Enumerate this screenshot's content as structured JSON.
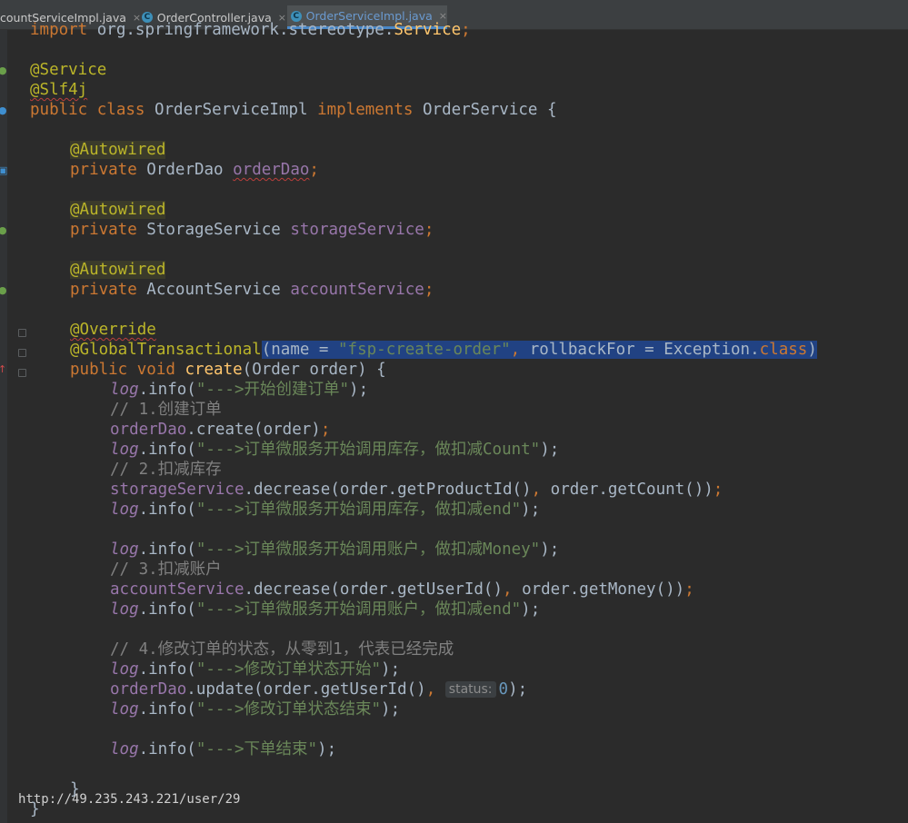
{
  "tabs": [
    {
      "label": "countServiceImpl.java",
      "icon": "",
      "close": "×"
    },
    {
      "label": "OrderController.java",
      "icon": "C",
      "close": "×"
    },
    {
      "label": "OrderServiceImpl.java",
      "icon": "C",
      "close": "×"
    }
  ],
  "code": {
    "line1": {
      "a": "import ",
      "b": "org.springframework.stereotype.",
      "c": "Service",
      "d": ";"
    },
    "line3": "@Service",
    "line4": "@Slf4j",
    "line5": {
      "a": "public class ",
      "b": "OrderServiceImpl ",
      "c": "implements ",
      "d": "OrderService {"
    },
    "line7": "@Autowired",
    "line8": {
      "a": "private ",
      "b": "OrderDao ",
      "c": "orderDao",
      "d": ";"
    },
    "line10": "@Autowired",
    "line11": {
      "a": "private ",
      "b": "StorageService ",
      "c": "storageService",
      "d": ";"
    },
    "line13": "@Autowired",
    "line14": {
      "a": "private ",
      "b": "AccountService ",
      "c": "accountService",
      "d": ";"
    },
    "line16": "@Override",
    "line17": {
      "a": "@GlobalTransactional",
      "b": "(name = ",
      "c": "\"fsp-create-order\"",
      "d": ", ",
      "e": "rollbackFor = Exception.",
      "f": "class",
      "g": ")"
    },
    "line18": {
      "a": "public void ",
      "b": "create",
      "c": "(Order order) {"
    },
    "line19": {
      "a": "log",
      "b": ".info(",
      "c": "\"--->开始创建订单\"",
      "d": ");"
    },
    "line20": "// 1.创建订单",
    "line21": {
      "a": "orderDao",
      "b": ".create(order)",
      "c": ";"
    },
    "line22": {
      "a": "log",
      "b": ".info(",
      "c": "\"--->订单微服务开始调用库存，做扣减Count\"",
      "d": ");"
    },
    "line23": "// 2.扣减库存",
    "line24": {
      "a": "storageService",
      "b": ".decrease(order.getProductId()",
      "c": ", ",
      "d": "order.getCount())",
      "e": ";"
    },
    "line25": {
      "a": "log",
      "b": ".info(",
      "c": "\"--->订单微服务开始调用库存，做扣减end\"",
      "d": ");"
    },
    "line27": {
      "a": "log",
      "b": ".info(",
      "c": "\"--->订单微服务开始调用账户，做扣减Money\"",
      "d": ");"
    },
    "line28": "// 3.扣减账户",
    "line29": {
      "a": "accountService",
      "b": ".decrease(order.getUserId()",
      "c": ", ",
      "d": "order.getMoney())",
      "e": ";"
    },
    "line30": {
      "a": "log",
      "b": ".info(",
      "c": "\"--->订单微服务开始调用账户，做扣减end\"",
      "d": ");"
    },
    "line32": "// 4.修改订单的状态，从零到1，代表已经完成",
    "line33": {
      "a": "log",
      "b": ".info(",
      "c": "\"--->修改订单状态开始\"",
      "d": ");"
    },
    "line34": {
      "a": "orderDao",
      "b": ".update(order.getUserId()",
      "c": ", ",
      "hint": "status:",
      "d": "0",
      "e": ");"
    },
    "line35": {
      "a": "log",
      "b": ".info(",
      "c": "\"--->修改订单状态结束\"",
      "d": ");"
    },
    "line37": {
      "a": "log",
      "b": ".info(",
      "c": "\"--->下单结束\"",
      "d": ");"
    },
    "line39": "}",
    "line40": "}"
  },
  "watermark": "http://49.235.243.221/user/29",
  "colors": {
    "background": "#2b2b2b",
    "keyword": "#cc7832",
    "annotation": "#bbb529",
    "field": "#9876aa",
    "string": "#6a8759",
    "comment": "#808080",
    "method": "#ffc66d",
    "number": "#6897bb",
    "selection": "#214283"
  }
}
